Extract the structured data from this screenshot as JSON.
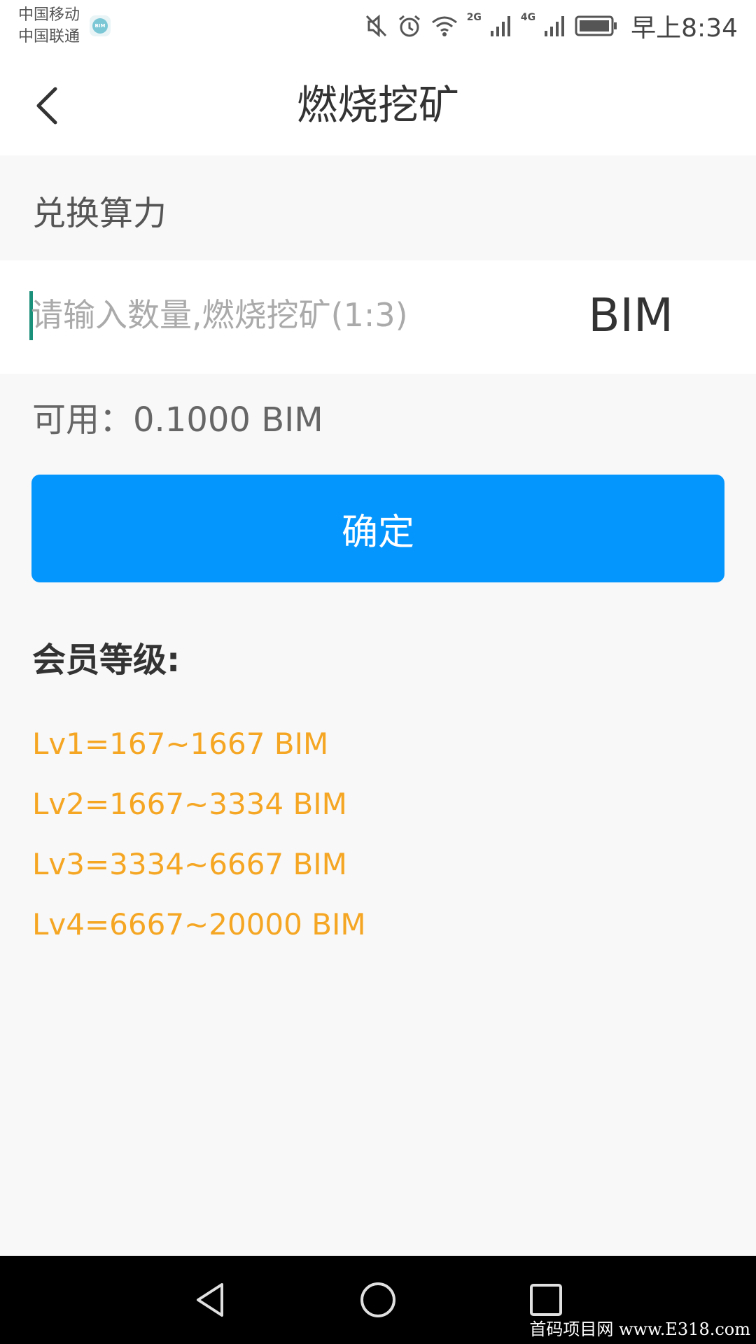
{
  "status_bar": {
    "carrier_1": "中国移动",
    "carrier_2": "中国联通",
    "app_badge": "BIM",
    "net_1": "2G",
    "net_2": "4G",
    "time": "早上8:34",
    "icons": [
      "mute-icon",
      "alarm-icon",
      "wifi-icon",
      "signal-2g-icon",
      "signal-4g-icon",
      "battery-icon"
    ]
  },
  "header": {
    "title": "燃烧挖矿",
    "back_icon": "chevron-left-icon"
  },
  "exchange": {
    "section_label": "兑换算力",
    "input_placeholder": "请输入数量,燃烧挖矿(1:3)",
    "input_value": "",
    "unit": "BIM",
    "available": "可用：0.1000 BIM",
    "confirm_label": "确定"
  },
  "levels": {
    "title": "会员等级:",
    "items": [
      "Lv1=167~1667 BIM",
      "Lv2=1667~3334 BIM",
      "Lv3=3334~6667 BIM",
      "Lv4=6667~20000 BIM"
    ],
    "color": "#f5a623"
  },
  "nav_bar": {
    "icons": [
      "back-triangle-icon",
      "home-circle-icon",
      "recents-square-icon"
    ]
  },
  "watermark": "首码项目网 www.E318.com",
  "colors": {
    "primary": "#0495fd",
    "accent": "#f5a623",
    "caret": "#1a8f7a"
  }
}
